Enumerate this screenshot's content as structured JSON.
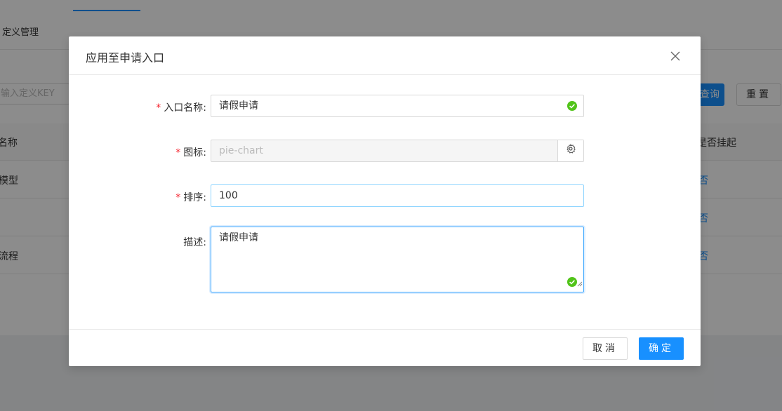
{
  "background": {
    "breadcrumb": "定义管理",
    "search_placeholder": "输入定义KEY",
    "query_button": "查询",
    "reset_button": "重置",
    "table": {
      "columns": [
        "名称",
        "是否挂起"
      ],
      "rows": [
        {
          "name": "模型",
          "suspended": "否"
        },
        {
          "name": "",
          "suspended": "否"
        },
        {
          "name": "流程",
          "suspended": "否"
        }
      ]
    }
  },
  "modal": {
    "title": "应用至申请入口",
    "fields": {
      "entry_name": {
        "label": "入口名称:",
        "value": "请假申请",
        "required": true,
        "valid": true
      },
      "icon": {
        "label": "图标:",
        "value": "pie-chart",
        "required": true,
        "disabled": true,
        "suffix_icon": "gear-icon"
      },
      "sort": {
        "label": "排序:",
        "value": "100",
        "required": true
      },
      "description": {
        "label": "描述:",
        "value": "请假申请",
        "required": false,
        "valid": true
      }
    },
    "footer": {
      "cancel_label": "取消",
      "ok_label": "确定"
    }
  },
  "colors": {
    "primary": "#1890ff",
    "required_star": "#f5222d",
    "valid_green": "#52c41a"
  }
}
